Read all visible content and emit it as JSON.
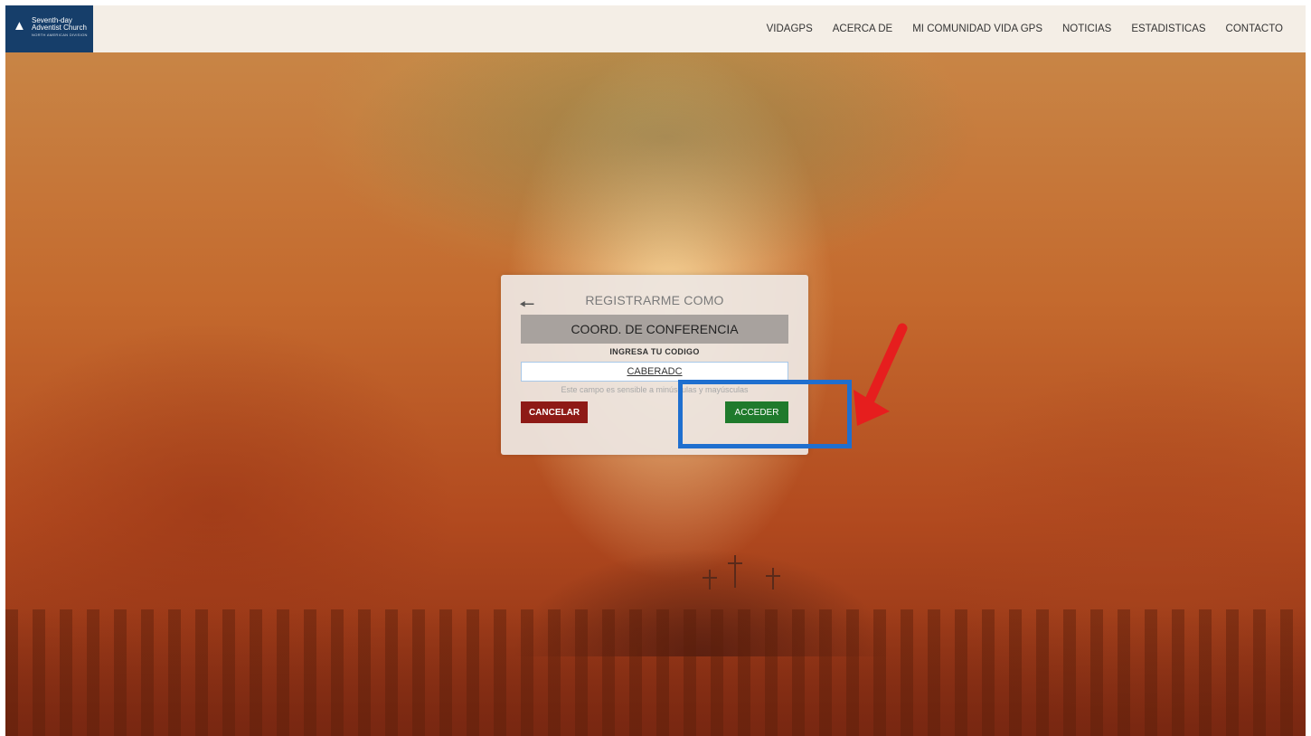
{
  "header": {
    "logo": {
      "line1": "Seventh-day",
      "line2": "Adventist Church",
      "line3": "NORTH AMERICAN DIVISION",
      "icon": "flame-icon"
    },
    "nav": [
      {
        "label": "VIDAGPS"
      },
      {
        "label": "ACERCA DE"
      },
      {
        "label": "MI COMUNIDAD VIDA GPS"
      },
      {
        "label": "NOTICIAS"
      },
      {
        "label": "ESTADISTICAS"
      },
      {
        "label": "CONTACTO"
      }
    ]
  },
  "modal": {
    "back_icon": "arrow-left-icon",
    "title": "REGISTRARME COMO",
    "role": "COORD. DE CONFERENCIA",
    "code_label": "INGRESA TU CODIGO",
    "code_value": "CABERADC",
    "hint": "Este campo es sensible a minúsculas y mayúsculas",
    "cancel_label": "CANCELAR",
    "access_label": "ACCEDER"
  },
  "annotations": {
    "highlight_color": "#1f6fcf",
    "arrow_color": "#e61e1e"
  },
  "colors": {
    "logo_bg": "#163e6a",
    "cancel_bg": "#8e1a16",
    "access_bg": "#1f7a2c"
  }
}
